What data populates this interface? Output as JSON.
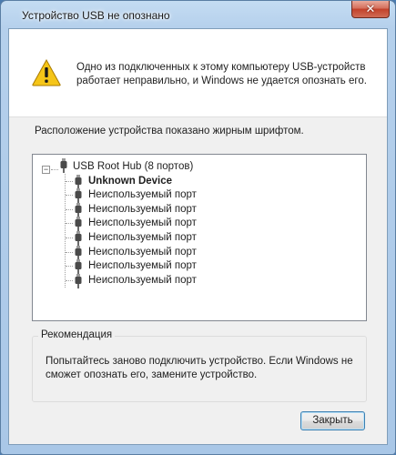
{
  "window": {
    "title": "Устройство USB не опознано"
  },
  "header": {
    "message": "Одно из подключенных к этому компьютеру USB-устройств работает неправильно, и Windows не удается опознать его."
  },
  "location_label": "Расположение устройства показано жирным шрифтом.",
  "tree": {
    "root": "USB Root Hub (8 портов)",
    "expander_symbol": "−",
    "items": [
      {
        "label": "Unknown Device",
        "bold": true
      },
      {
        "label": "Неиспользуемый порт",
        "bold": false
      },
      {
        "label": "Неиспользуемый порт",
        "bold": false
      },
      {
        "label": "Неиспользуемый порт",
        "bold": false
      },
      {
        "label": "Неиспользуемый порт",
        "bold": false
      },
      {
        "label": "Неиспользуемый порт",
        "bold": false
      },
      {
        "label": "Неиспользуемый порт",
        "bold": false
      },
      {
        "label": "Неиспользуемый порт",
        "bold": false
      }
    ]
  },
  "recommendation": {
    "title": "Рекомендация",
    "text": "Попытайтесь заново подключить устройство. Если Windows не сможет опознать его, замените устройство."
  },
  "buttons": {
    "close_label": "Закрыть",
    "titlebar_close_glyph": "✕"
  },
  "icons": {
    "warning": "warning-icon",
    "usb_plug": "usb-plug-icon"
  },
  "colors": {
    "warning_fill": "#f5c518",
    "titlebar": "#b9d3ee",
    "close_button": "#c94a35"
  }
}
